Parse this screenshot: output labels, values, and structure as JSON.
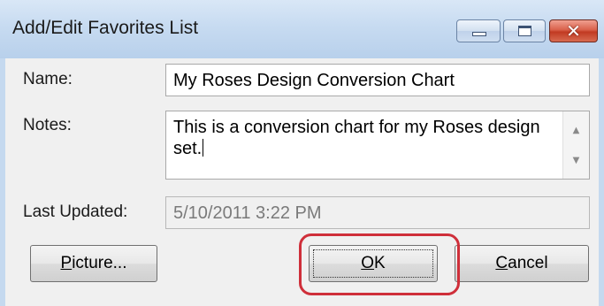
{
  "window": {
    "title": "Add/Edit Favorites List",
    "controls": {
      "minimize_icon": "minimize-icon",
      "maximize_icon": "maximize-icon",
      "close_icon": "close-icon",
      "close_glyph": "✕"
    }
  },
  "form": {
    "name_label": "Name:",
    "name_value": "My Roses Design Conversion Chart",
    "notes_label": "Notes:",
    "notes_value": "This is a conversion chart for my Roses design set.",
    "last_updated_label": "Last Updated:",
    "last_updated_value": "5/10/2011 3:22 PM"
  },
  "scrollbar": {
    "up_glyph": "▲",
    "down_glyph": "▼"
  },
  "buttons": {
    "picture": {
      "mnemonic": "P",
      "rest": "icture..."
    },
    "ok": {
      "mnemonic": "O",
      "rest": "K"
    },
    "cancel": {
      "mnemonic": "C",
      "rest": "ancel"
    }
  },
  "colors": {
    "highlight": "#cf2f3a",
    "title_bar": "#c7dbf1",
    "dialog_background": "#f0f0f0"
  }
}
